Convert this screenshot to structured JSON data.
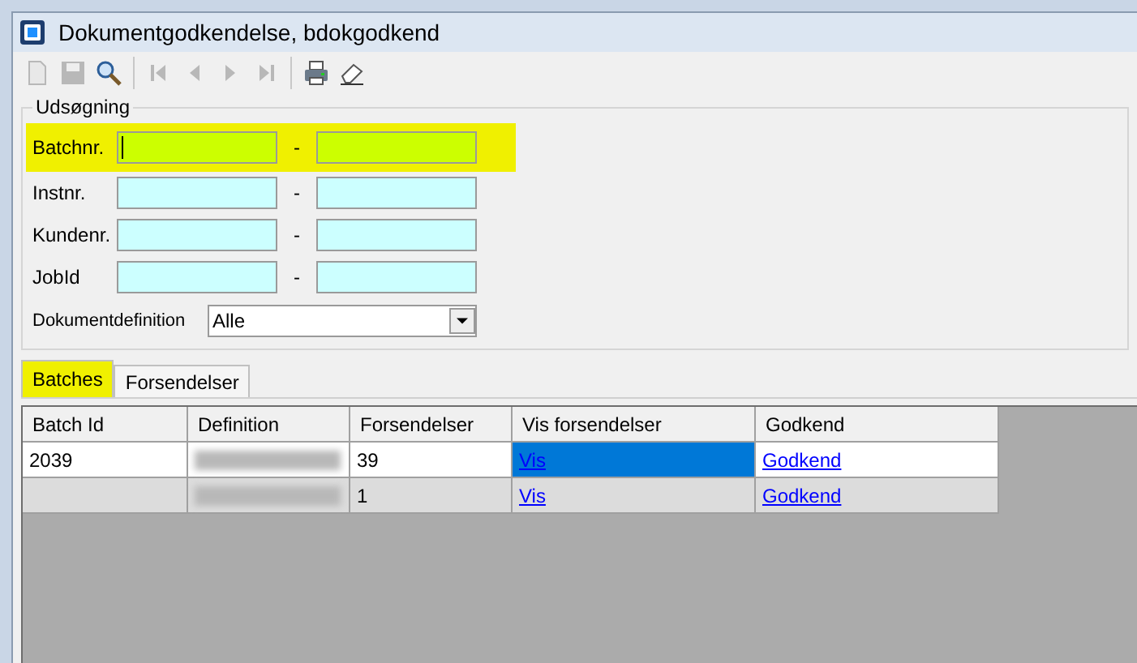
{
  "window": {
    "title": "Dokumentgodkendelse, bdokgodkend"
  },
  "toolbar": [
    {
      "kind": "new",
      "disabled": true
    },
    {
      "kind": "save",
      "disabled": true
    },
    {
      "kind": "search",
      "disabled": false
    },
    {
      "kind": "sep"
    },
    {
      "kind": "first",
      "disabled": true
    },
    {
      "kind": "prev",
      "disabled": true
    },
    {
      "kind": "next",
      "disabled": true
    },
    {
      "kind": "last",
      "disabled": true
    },
    {
      "kind": "sep"
    },
    {
      "kind": "print",
      "disabled": false
    },
    {
      "kind": "erase",
      "disabled": false
    }
  ],
  "search": {
    "title": "Udsøgning",
    "ranges": [
      {
        "label": "Batchnr.",
        "separator": "-",
        "highlighted": true,
        "focused": true
      },
      {
        "label": "Instnr.",
        "separator": "-",
        "highlighted": false,
        "focused": false
      },
      {
        "label": "Kundenr.",
        "separator": "-",
        "highlighted": false,
        "focused": false
      },
      {
        "label": "JobId",
        "separator": "-",
        "highlighted": false,
        "focused": false
      }
    ],
    "definition": {
      "label": "Dokumentdefinition",
      "value": "Alle"
    }
  },
  "tabs": [
    {
      "label": "Batches",
      "selected": true,
      "highlighted": true
    },
    {
      "label": "Forsendelser",
      "selected": false,
      "highlighted": false
    }
  ],
  "table": {
    "columns": [
      "Batch Id",
      "Definition",
      "Forsendelser",
      "Vis forsendelser",
      "Godkend"
    ],
    "rows": [
      {
        "batch_id": "2039",
        "definition_blurred": true,
        "forsendelser": "39",
        "vis": "Vis",
        "vis_selected": true,
        "godkend": "Godkend",
        "shaded": false
      },
      {
        "batch_id": "",
        "definition_blurred": true,
        "forsendelser": "1",
        "vis": "Vis",
        "vis_selected": false,
        "godkend": "Godkend",
        "shaded": true
      }
    ]
  }
}
